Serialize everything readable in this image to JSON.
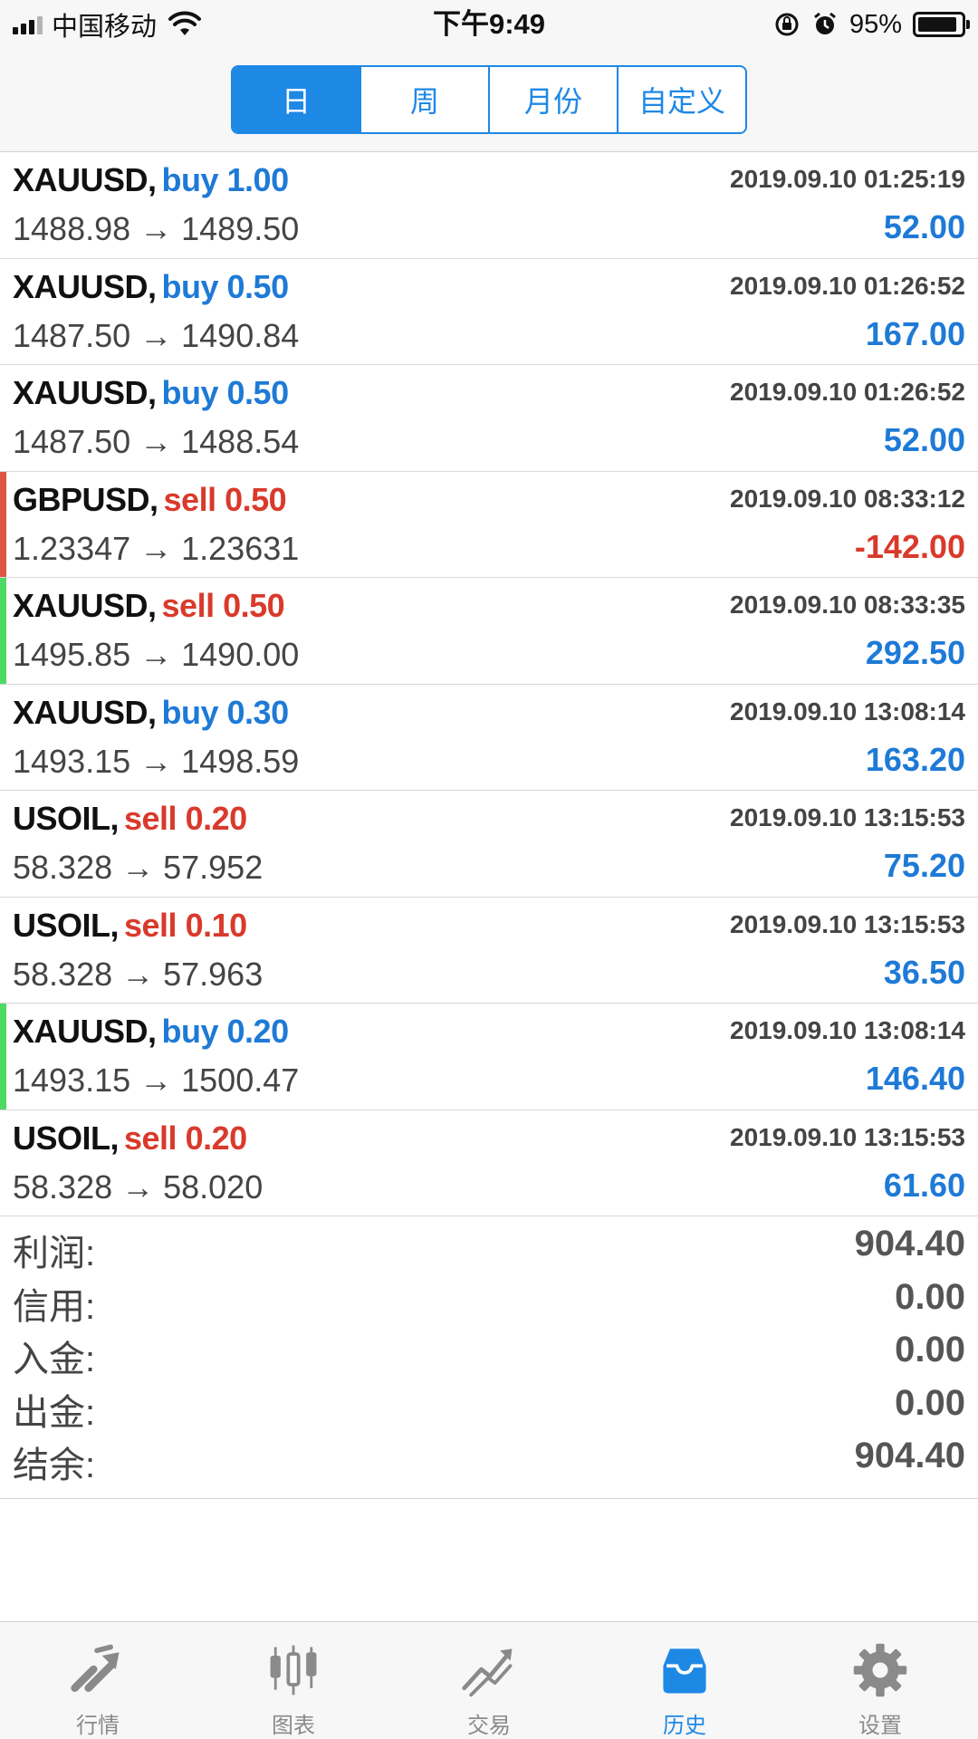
{
  "status_bar": {
    "carrier": "中国移动",
    "time": "下午9:49",
    "battery": "95%"
  },
  "period_tabs": [
    {
      "label": "日",
      "active": true
    },
    {
      "label": "周",
      "active": false
    },
    {
      "label": "月份",
      "active": false
    },
    {
      "label": "自定义",
      "active": false
    }
  ],
  "trades": [
    {
      "symbol": "XAUUSD,",
      "side": "buy",
      "trade": "buy 1.00",
      "time": "2019.09.10 01:25:19",
      "prices": "1488.98 → 1489.50",
      "profit": "52.00",
      "marker": ""
    },
    {
      "symbol": "XAUUSD,",
      "side": "buy",
      "trade": "buy 0.50",
      "time": "2019.09.10 01:26:52",
      "prices": "1487.50 → 1490.84",
      "profit": "167.00",
      "marker": ""
    },
    {
      "symbol": "XAUUSD,",
      "side": "buy",
      "trade": "buy 0.50",
      "time": "2019.09.10 01:26:52",
      "prices": "1487.50 → 1488.54",
      "profit": "52.00",
      "marker": ""
    },
    {
      "symbol": "GBPUSD,",
      "side": "sell",
      "trade": "sell 0.50",
      "time": "2019.09.10 08:33:12",
      "prices": "1.23347 → 1.23631",
      "profit": "-142.00",
      "marker": "#e05545"
    },
    {
      "symbol": "XAUUSD,",
      "side": "sell",
      "trade": "sell 0.50",
      "time": "2019.09.10 08:33:35",
      "prices": "1495.85 → 1490.00",
      "profit": "292.50",
      "marker": "#4cd964"
    },
    {
      "symbol": "XAUUSD,",
      "side": "buy",
      "trade": "buy 0.30",
      "time": "2019.09.10 13:08:14",
      "prices": "1493.15 → 1498.59",
      "profit": "163.20",
      "marker": ""
    },
    {
      "symbol": "USOIL,",
      "side": "sell",
      "trade": "sell 0.20",
      "time": "2019.09.10 13:15:53",
      "prices": "58.328 → 57.952",
      "profit": "75.20",
      "marker": ""
    },
    {
      "symbol": "USOIL,",
      "side": "sell",
      "trade": "sell 0.10",
      "time": "2019.09.10 13:15:53",
      "prices": "58.328 → 57.963",
      "profit": "36.50",
      "marker": ""
    },
    {
      "symbol": "XAUUSD,",
      "side": "buy",
      "trade": "buy 0.20",
      "time": "2019.09.10 13:08:14",
      "prices": "1493.15 → 1500.47",
      "profit": "146.40",
      "marker": "#4cd964"
    },
    {
      "symbol": "USOIL,",
      "side": "sell",
      "trade": "sell 0.20",
      "time": "2019.09.10 13:15:53",
      "prices": "58.328 → 58.020",
      "profit": "61.60",
      "marker": ""
    }
  ],
  "summary": [
    {
      "label": "利润:",
      "value": "904.40"
    },
    {
      "label": "信用:",
      "value": "0.00"
    },
    {
      "label": "入金:",
      "value": "0.00"
    },
    {
      "label": "出金:",
      "value": "0.00"
    },
    {
      "label": "结余:",
      "value": "904.40"
    }
  ],
  "tab_bar": [
    {
      "label": "行情",
      "icon": "quotes-icon",
      "active": false
    },
    {
      "label": "图表",
      "icon": "chart-icon",
      "active": false
    },
    {
      "label": "交易",
      "icon": "trade-icon",
      "active": false
    },
    {
      "label": "历史",
      "icon": "history-icon",
      "active": true
    },
    {
      "label": "设置",
      "icon": "settings-icon",
      "active": false
    }
  ],
  "colors": {
    "accent": "#1e88e5",
    "buy": "#1e7ad6",
    "sell": "#d93a2b",
    "tab_inactive": "#8a8a8a"
  }
}
